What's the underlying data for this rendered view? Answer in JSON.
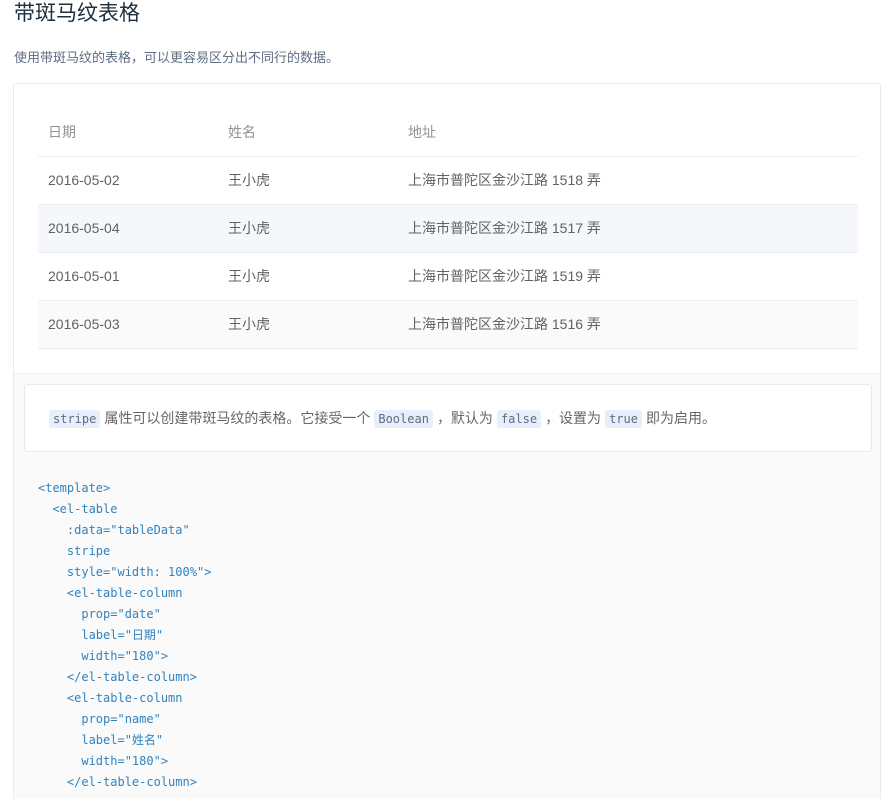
{
  "header": {
    "title": "带斑马纹表格",
    "description": "使用带斑马纹的表格，可以更容易区分出不同行的数据。"
  },
  "table": {
    "columns": [
      "日期",
      "姓名",
      "地址"
    ],
    "rows": [
      {
        "date": "2016-05-02",
        "name": "王小虎",
        "address": "上海市普陀区金沙江路 1518 弄"
      },
      {
        "date": "2016-05-04",
        "name": "王小虎",
        "address": "上海市普陀区金沙江路 1517 弄"
      },
      {
        "date": "2016-05-01",
        "name": "王小虎",
        "address": "上海市普陀区金沙江路 1519 弄"
      },
      {
        "date": "2016-05-03",
        "name": "王小虎",
        "address": "上海市普陀区金沙江路 1516 弄"
      }
    ]
  },
  "meta": {
    "parts": {
      "code_stripe": "stripe",
      "text_1": "属性可以创建带斑马纹的表格。它接受一个",
      "code_boolean": "Boolean",
      "text_2": "，默认为",
      "code_false": "false",
      "text_3": "，设置为",
      "code_true": "true",
      "text_4": "即为启用。"
    },
    "code_lines": [
      "<template>",
      "  <el-table",
      "    :data=\"tableData\"",
      "    stripe",
      "    style=\"width: 100%\">",
      "    <el-table-column",
      "      prop=\"date\"",
      "      label=\"日期\"",
      "      width=\"180\">",
      "    </el-table-column>",
      "    <el-table-column",
      "      prop=\"name\"",
      "      label=\"姓名\"",
      "      width=\"180\">",
      "    </el-table-column>"
    ]
  }
}
